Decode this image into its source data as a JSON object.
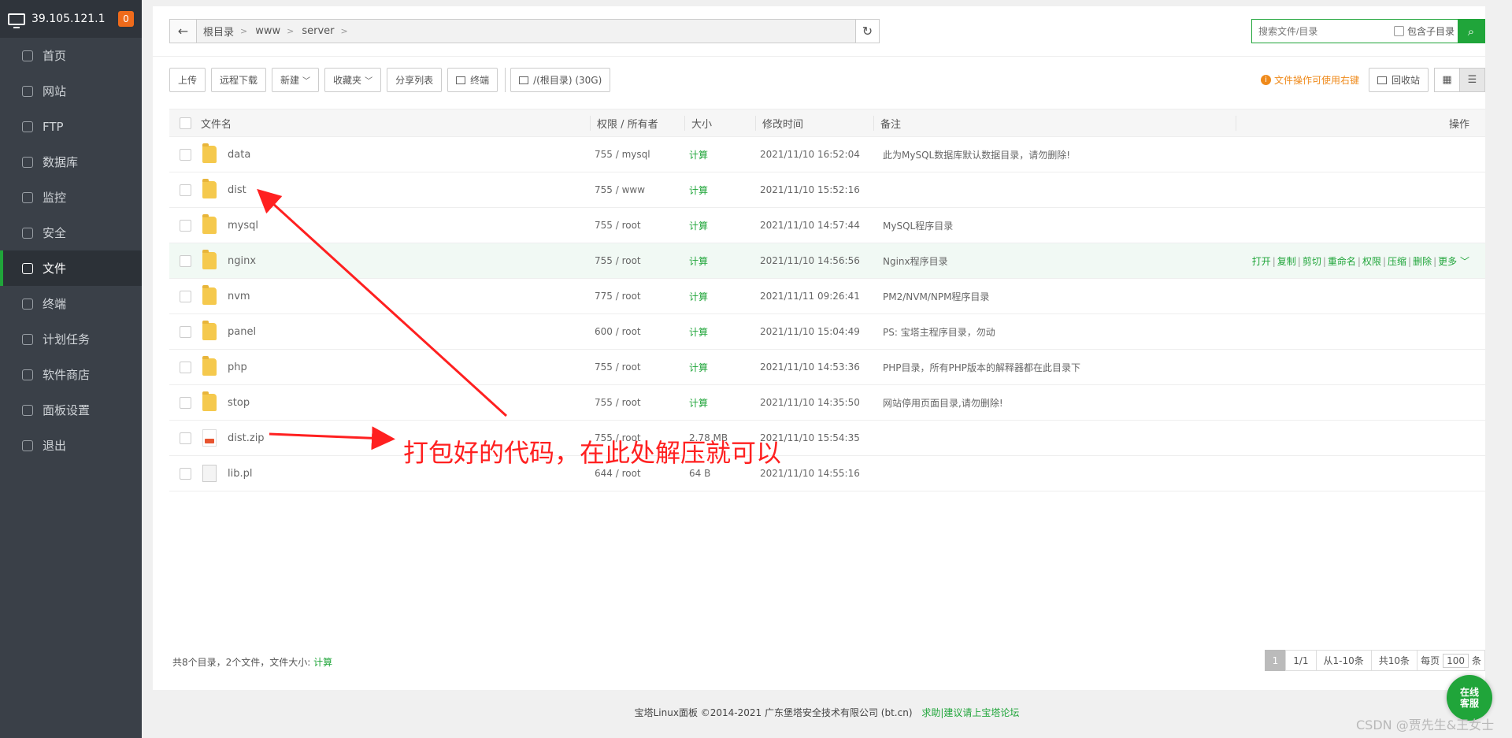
{
  "sidebar": {
    "server_ip": "39.105.121.1",
    "badge": "0",
    "items": [
      {
        "label": "首页",
        "icon": "home-icon"
      },
      {
        "label": "网站",
        "icon": "globe-icon"
      },
      {
        "label": "FTP",
        "icon": "ftp-icon"
      },
      {
        "label": "数据库",
        "icon": "database-icon"
      },
      {
        "label": "监控",
        "icon": "monitor-icon"
      },
      {
        "label": "安全",
        "icon": "shield-icon"
      },
      {
        "label": "文件",
        "icon": "folder-icon",
        "active": true
      },
      {
        "label": "终端",
        "icon": "terminal-icon"
      },
      {
        "label": "计划任务",
        "icon": "calendar-icon"
      },
      {
        "label": "软件商店",
        "icon": "apps-icon"
      },
      {
        "label": "面板设置",
        "icon": "settings-icon"
      },
      {
        "label": "退出",
        "icon": "logout-icon"
      }
    ]
  },
  "path": {
    "back_icon": "←",
    "crumbs": [
      "根目录",
      "www",
      "server"
    ],
    "refresh_icon": "↻"
  },
  "search": {
    "placeholder": "搜索文件/目录",
    "include_sub": "包含子目录",
    "go_icon": "⌕"
  },
  "toolbar": {
    "upload": "上传",
    "remote_download": "远程下载",
    "new": "新建",
    "favorites": "收藏夹",
    "share_list": "分享列表",
    "terminal": "终端",
    "disk": "/(根目录) (30G)",
    "tip": "文件操作可使用右键",
    "recycle": "回收站"
  },
  "table": {
    "headers": {
      "name": "文件名",
      "perm": "权限 / 所有者",
      "size": "大小",
      "mtime": "修改时间",
      "note": "备注",
      "ops": "操作"
    },
    "rows": [
      {
        "name": "data",
        "type": "folder",
        "perm": "755 / mysql",
        "size": "计算",
        "mtime": "2021/11/10 16:52:04",
        "note": "此为MySQL数据库默认数据目录，请勿删除!"
      },
      {
        "name": "dist",
        "type": "folder",
        "perm": "755 / www",
        "size": "计算",
        "mtime": "2021/11/10 15:52:16",
        "note": ""
      },
      {
        "name": "mysql",
        "type": "folder",
        "perm": "755 / root",
        "size": "计算",
        "mtime": "2021/11/10 14:57:44",
        "note": "MySQL程序目录"
      },
      {
        "name": "nginx",
        "type": "folder",
        "perm": "755 / root",
        "size": "计算",
        "mtime": "2021/11/10 14:56:56",
        "note": "Nginx程序目录",
        "hover": true
      },
      {
        "name": "nvm",
        "type": "folder",
        "perm": "775 / root",
        "size": "计算",
        "mtime": "2021/11/11 09:26:41",
        "note": "PM2/NVM/NPM程序目录"
      },
      {
        "name": "panel",
        "type": "folder",
        "perm": "600 / root",
        "size": "计算",
        "mtime": "2021/11/10 15:04:49",
        "note": "PS: 宝塔主程序目录，勿动"
      },
      {
        "name": "php",
        "type": "folder",
        "perm": "755 / root",
        "size": "计算",
        "mtime": "2021/11/10 14:53:36",
        "note": "PHP目录，所有PHP版本的解释器都在此目录下"
      },
      {
        "name": "stop",
        "type": "folder",
        "perm": "755 / root",
        "size": "计算",
        "mtime": "2021/11/10 14:35:50",
        "note": "网站停用页面目录,请勿删除!"
      },
      {
        "name": "dist.zip",
        "type": "zip",
        "perm": "755 / root",
        "size": "2.78 MB",
        "mtime": "2021/11/10 15:54:35",
        "note": ""
      },
      {
        "name": "lib.pl",
        "type": "file",
        "perm": "644 / root",
        "size": "64 B",
        "mtime": "2021/11/10 14:55:16",
        "note": ""
      }
    ],
    "row_ops": [
      "打开",
      "复制",
      "剪切",
      "重命名",
      "权限",
      "压缩",
      "删除",
      "更多"
    ]
  },
  "summary": {
    "text": "共8个目录，2个文件，文件大小:",
    "calc": "计算"
  },
  "pager": {
    "current": "1",
    "pages": "1/1",
    "range": "从1-10条",
    "total": "共10条",
    "per_page_label": "每页",
    "per_page": "100",
    "unit": "条"
  },
  "footer": {
    "copyright": "宝塔Linux面板 ©2014-2021 广东堡塔安全技术有限公司 (bt.cn)",
    "help": "求助|建议请上宝塔论坛"
  },
  "online_service": [
    "在线",
    "客服"
  ],
  "watermark": "CSDN @贾先生&王女士",
  "annotation": "打包好的代码，在此处解压就可以",
  "colors": {
    "accent": "#20a53a",
    "sidebar": "#3a4048",
    "annotation": "#ff2020",
    "tip": "#ef8a1b"
  }
}
